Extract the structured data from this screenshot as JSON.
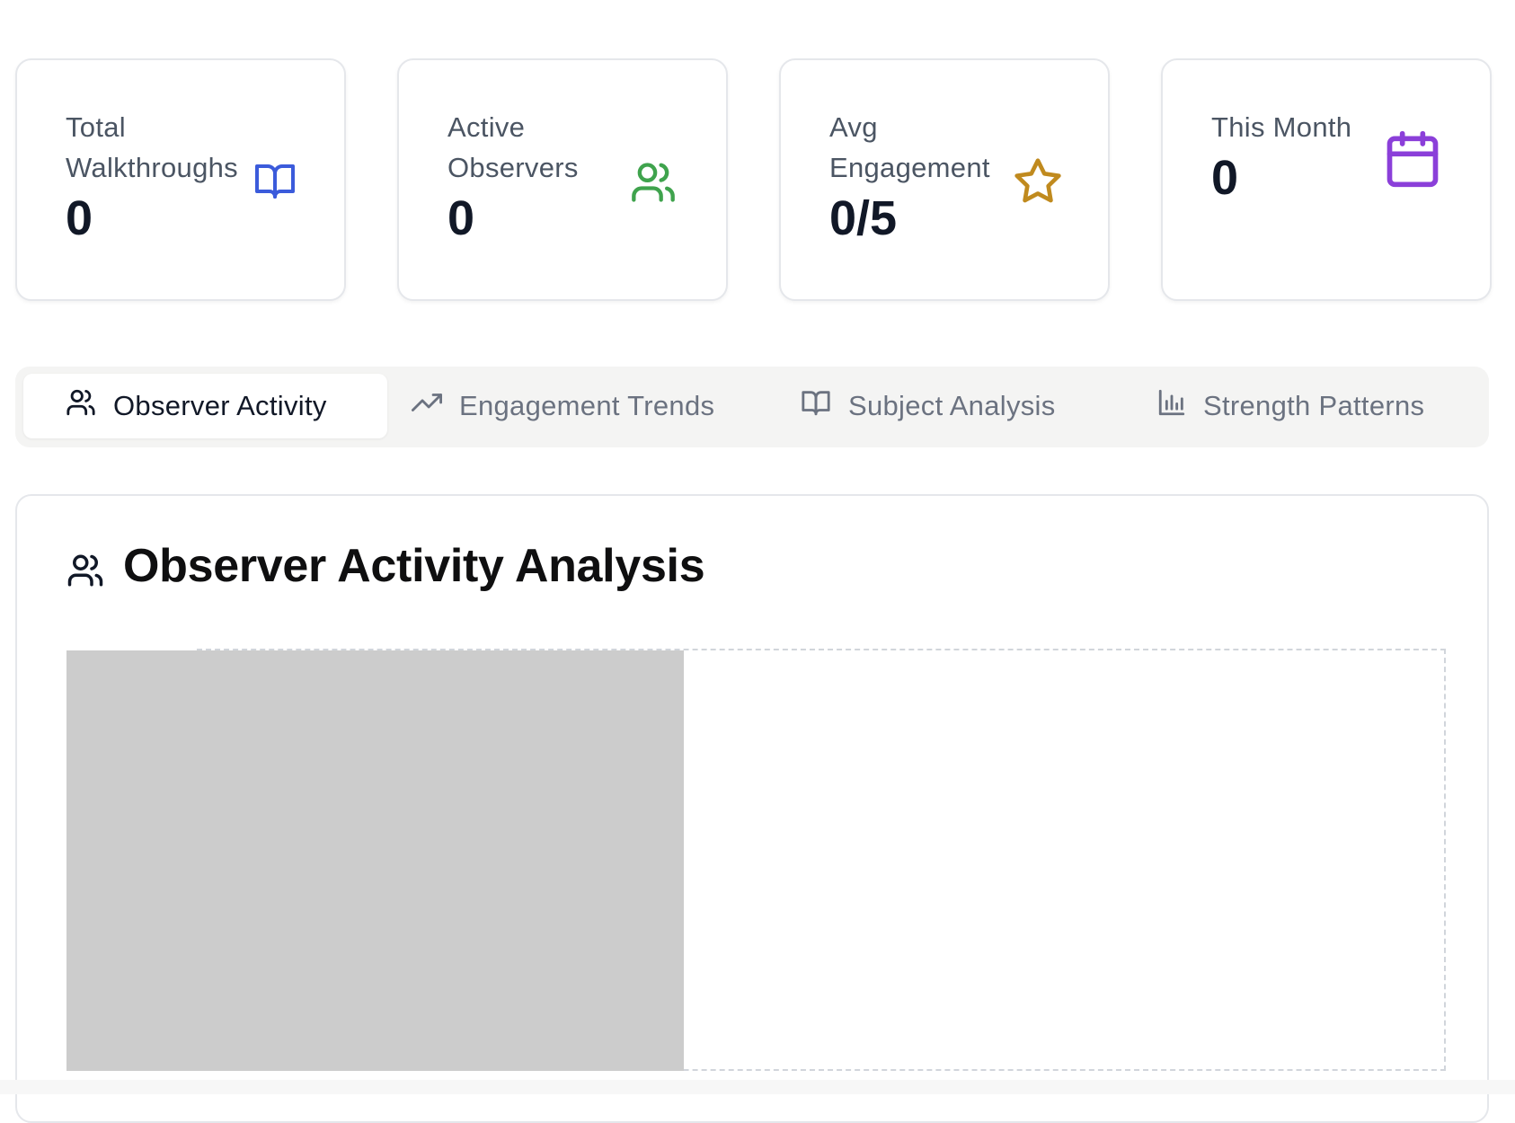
{
  "stats": [
    {
      "label": "Total Walkthroughs",
      "value": "0",
      "icon": "book-open-icon",
      "color": "#3b5bdb"
    },
    {
      "label": "Active Observers",
      "value": "0",
      "icon": "users-icon",
      "color": "#3fa34d"
    },
    {
      "label": "Avg Engagement",
      "value": "0/5",
      "icon": "star-icon",
      "color": "#c08a1e"
    },
    {
      "label": "This Month",
      "value": "0",
      "icon": "calendar-icon",
      "color": "#8b3fd9"
    }
  ],
  "tabs": [
    {
      "label": "Observer Activity",
      "icon": "users-icon",
      "active": true
    },
    {
      "label": "Engagement Trends",
      "icon": "trending-up-icon",
      "active": false
    },
    {
      "label": "Subject Analysis",
      "icon": "book-open-icon",
      "active": false
    },
    {
      "label": "Strength Patterns",
      "icon": "bar-chart-icon",
      "active": false
    }
  ],
  "panel": {
    "title": "Observer Activity Analysis",
    "icon": "users-icon"
  }
}
